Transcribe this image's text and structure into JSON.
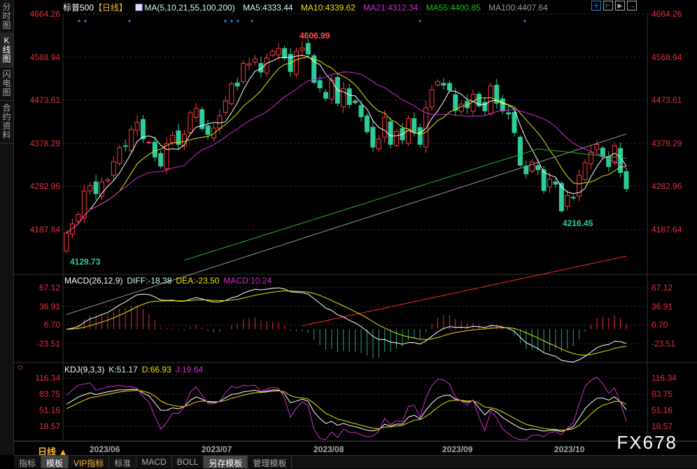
{
  "sidebar": [
    "分时图",
    "K线图",
    "闪电图",
    "合约资料"
  ],
  "header": {
    "title": "标普500",
    "period_tag": "【日线】",
    "ma_label": "MA(5,10,21,55,100,200)",
    "ma5": "MA5:4333.44",
    "ma10": "MA10:4339.62",
    "ma21": "MA21:4312.34",
    "ma55": "MA55:4400.85",
    "ma100": "MA100:4407.64"
  },
  "colors": {
    "up": "#ff3b3b",
    "down": "#2ecc9a",
    "ma5": "#ffffff",
    "ma10": "#e6e600",
    "ma21": "#d42ad4",
    "ma55": "#22bb22",
    "ma100": "#999999",
    "ma200": "#ff2a2a"
  },
  "price_axis": [
    "4664.26",
    "4568.94",
    "4473.61",
    "4378.29",
    "4282.96",
    "4187.64"
  ],
  "annotations": {
    "high": "4606.99",
    "low1": "4129.73",
    "low2": "4216.45"
  },
  "macd": {
    "label": "MACD(26,12,9)",
    "diff": "DIFF:-18.38",
    "dea": "DEA:-23.50",
    "macd": "MACD:10.24",
    "axis": [
      "67.12",
      "36.91",
      "6.70",
      "-23.51"
    ]
  },
  "kdj": {
    "label": "KDJ(9,3,3)",
    "k": "K:51.17",
    "d": "D:66.93",
    "j": "J:19.64",
    "axis": [
      "116.34",
      "83.75",
      "51.16",
      "18.57"
    ]
  },
  "dates": [
    "2023/06",
    "2023/07",
    "2023/08",
    "2023/09",
    "2023/10"
  ],
  "period": "日线 ▲",
  "tabs": [
    "指标",
    "模板",
    "VIP指标",
    "标准",
    "MACD",
    "BOLL",
    "另存模板",
    "管理模板"
  ],
  "watermark": "FX678",
  "chart_data": {
    "type": "candlestick",
    "closes": [
      4180,
      4200,
      4221,
      4273,
      4285,
      4267,
      4293,
      4298,
      4338,
      4369,
      4372,
      4409,
      4425,
      4388,
      4381,
      4348,
      4328,
      4378,
      4396,
      4376,
      4398,
      4446,
      4455,
      4411,
      4398,
      4412,
      4439,
      4472,
      4510,
      4505,
      4555,
      4554,
      4565,
      4536,
      4567,
      4582,
      4588,
      4567,
      4537,
      4582,
      4589,
      4576,
      4513,
      4501,
      4478,
      4518,
      4467,
      4499,
      4464,
      4468,
      4437,
      4404,
      4370,
      4388,
      4436,
      4376,
      4405,
      4386,
      4433,
      4405,
      4376,
      4457,
      4497,
      4515,
      4507,
      4496,
      4451,
      4465,
      4457,
      4487,
      4461,
      4450,
      4505,
      4467,
      4450,
      4443,
      4402,
      4330,
      4311,
      4337,
      4320,
      4274,
      4299,
      4288,
      4229,
      4263,
      4258,
      4308,
      4335,
      4358,
      4376,
      4349,
      4327,
      4373,
      4314,
      4278
    ],
    "open_first": 4140
  }
}
